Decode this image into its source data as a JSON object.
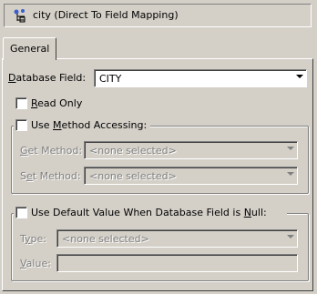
{
  "header": {
    "title": "city (Direct To Field Mapping)",
    "icon": "direct-to-field-mapping-icon"
  },
  "tabs": [
    {
      "label": "General",
      "selected": true
    }
  ],
  "form": {
    "database_field": {
      "label": "Database Field:",
      "value": "CITY"
    },
    "read_only": {
      "label": "Read Only",
      "checked": false
    },
    "use_method_accessing": {
      "label": "Use Method Accessing:",
      "checked": false,
      "get_method": {
        "label": "Get Method:",
        "value": "<none selected>"
      },
      "set_method": {
        "label": "Set Method:",
        "value": "<none selected>"
      }
    },
    "null_default": {
      "label": "Use Default Value When Database Field is Null:",
      "checked": false,
      "type": {
        "label": "Type:",
        "value": "<none selected>"
      },
      "value": {
        "label": "Value:",
        "value": ""
      }
    }
  }
}
